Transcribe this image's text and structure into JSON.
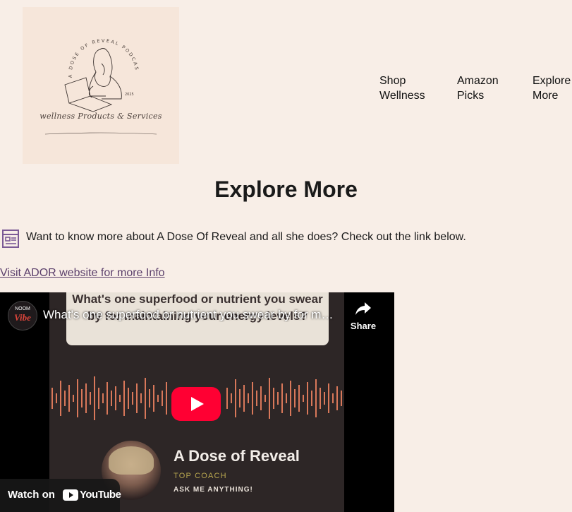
{
  "logo": {
    "arc_text": "A DOSE OF REVEAL PODCAST",
    "year": "2025",
    "tagline": "wellness Products & Services"
  },
  "nav": {
    "items": [
      {
        "line1": "Shop",
        "line2": "Wellness"
      },
      {
        "line1": "Amazon",
        "line2": "Picks"
      },
      {
        "line1": "Explore",
        "line2": "More"
      }
    ]
  },
  "page": {
    "title": "Explore More",
    "description": "Want to know more about A Dose Of Reveal and all she does? Check out the link below.",
    "link_text": "Visit ADOR website for more Info"
  },
  "video": {
    "channel_top": "NOOM",
    "channel_bottom": "Vibe",
    "title": "What's one superfood or nutrient you swear by for maintaining your energy levels?",
    "question": "What's one superfood or nutrient you swear by for maintaining your energy levels?",
    "share_label": "Share",
    "host_name": "A Dose of Reveal",
    "host_role": "TOP COACH",
    "host_cta": "ASK ME ANYTHING!",
    "watch_on": "Watch on",
    "youtube_word": "YouTube"
  },
  "colors": {
    "page_bg": "#f8eee7",
    "link": "#5b3f6b",
    "icon": "#7b5a96",
    "youtube_red": "#ff0033",
    "waveform": "#d9785a"
  }
}
